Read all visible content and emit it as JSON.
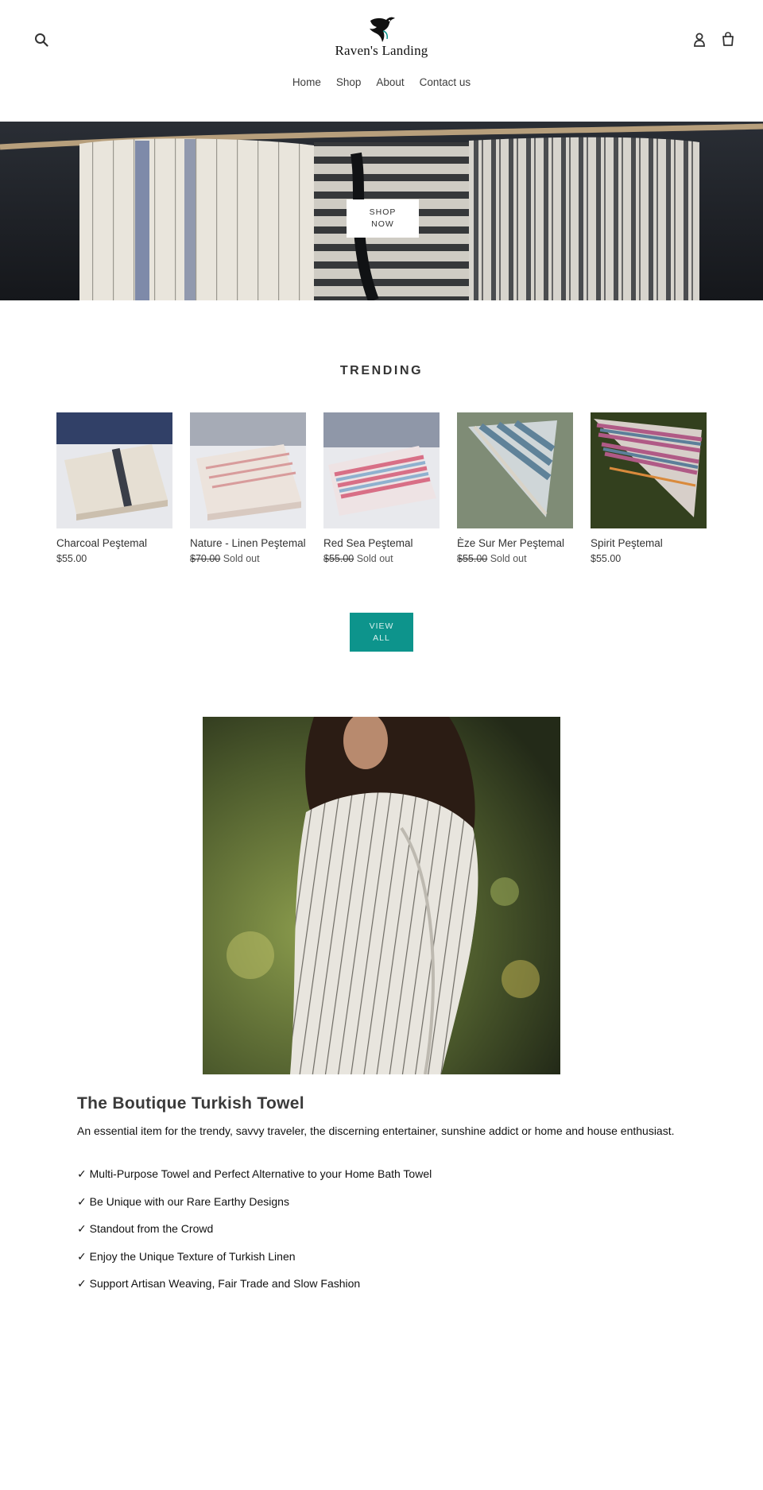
{
  "brand": {
    "name": "Raven's Landing"
  },
  "header": {
    "nav": [
      "Home",
      "Shop",
      "About",
      "Contact us"
    ]
  },
  "hero": {
    "button_line1": "SHOP",
    "button_line2": "NOW"
  },
  "trending": {
    "title": "TRENDING",
    "products": [
      {
        "name": "Charcoal Peştemal",
        "price": "$55.00",
        "original_price": "",
        "status": ""
      },
      {
        "name": "Nature - Linen Peştemal",
        "price": "",
        "original_price": "$70.00",
        "status": "Sold out"
      },
      {
        "name": "Red Sea Peştemal",
        "price": "",
        "original_price": "$55.00",
        "status": "Sold out"
      },
      {
        "name": "Èze Sur Mer Peştemal",
        "price": "",
        "original_price": "$55.00",
        "status": "Sold out"
      },
      {
        "name": "Spirit Peştemal",
        "price": "$55.00",
        "original_price": "",
        "status": ""
      }
    ],
    "view_all_line1": "VIEW",
    "view_all_line2": "ALL"
  },
  "feature": {
    "title": "The Boutique Turkish Towel",
    "description": "An essential item for the trendy, savvy traveler, the discerning entertainer, sunshine addict or home and house enthusiast.",
    "bullets": [
      "✓ Multi-Purpose Towel and Perfect Alternative to your Home Bath Towel",
      "✓ Be Unique with our Rare Earthy Designs",
      "✓ Standout from the Crowd",
      "✓ Enjoy the Unique Texture of Turkish Linen",
      "✓ Support Artisan Weaving, Fair Trade and Slow Fashion"
    ]
  },
  "colors": {
    "accent": "#0d948c",
    "hero_bg": "#1f2227",
    "text": "#3a3a3a"
  },
  "icons": [
    "search-icon",
    "raven-logo-icon",
    "account-icon",
    "cart-icon"
  ]
}
